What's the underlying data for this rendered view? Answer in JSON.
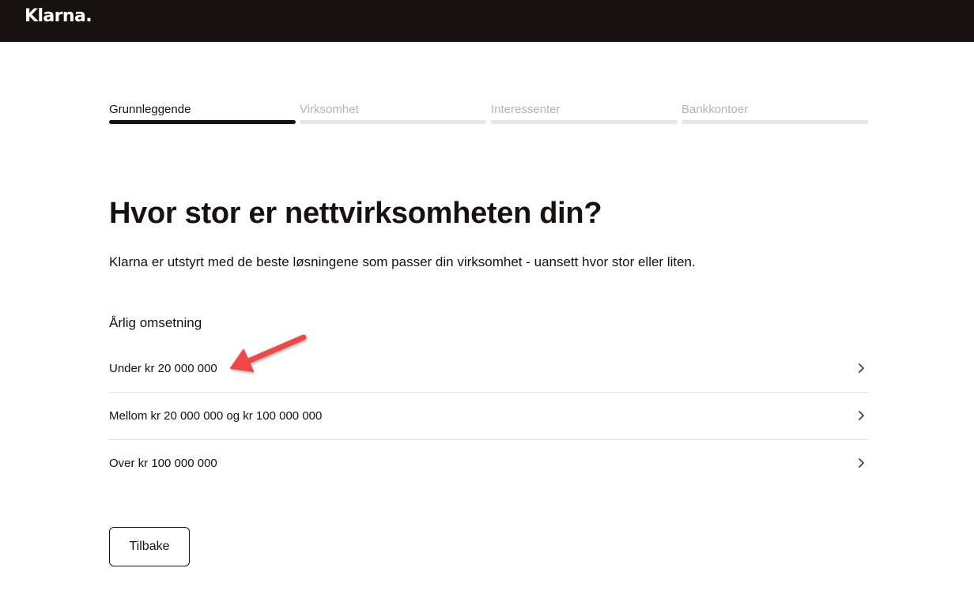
{
  "header": {
    "logo": "Klarna."
  },
  "steps": [
    {
      "label": "Grunnleggende",
      "state": "active"
    },
    {
      "label": "Virksomhet",
      "state": "inactive"
    },
    {
      "label": "Interessenter",
      "state": "inactive"
    },
    {
      "label": "Bankkontoer",
      "state": "inactive"
    }
  ],
  "main": {
    "title": "Hvor stor er nettvirksomheten din?",
    "intro": "Klarna er utstyrt med de beste løsningene som passer din virksomhet - uansett hvor stor eller liten.",
    "section_label": "Årlig omsetning",
    "options": [
      {
        "label": "Under kr 20 000 000",
        "icon": "chevron-right-icon"
      },
      {
        "label": "Mellom kr 20 000 000 og kr 100 000 000",
        "icon": "chevron-right-icon"
      },
      {
        "label": "Over kr 100 000 000",
        "icon": "chevron-right-icon"
      }
    ],
    "back_label": "Tilbake"
  },
  "annotation": {
    "icon": "red-arrow-icon",
    "color": "#f0464a"
  },
  "colors": {
    "topbar": "#17120f",
    "active_step": "#17120f",
    "inactive_step": "#e6e6e6"
  }
}
